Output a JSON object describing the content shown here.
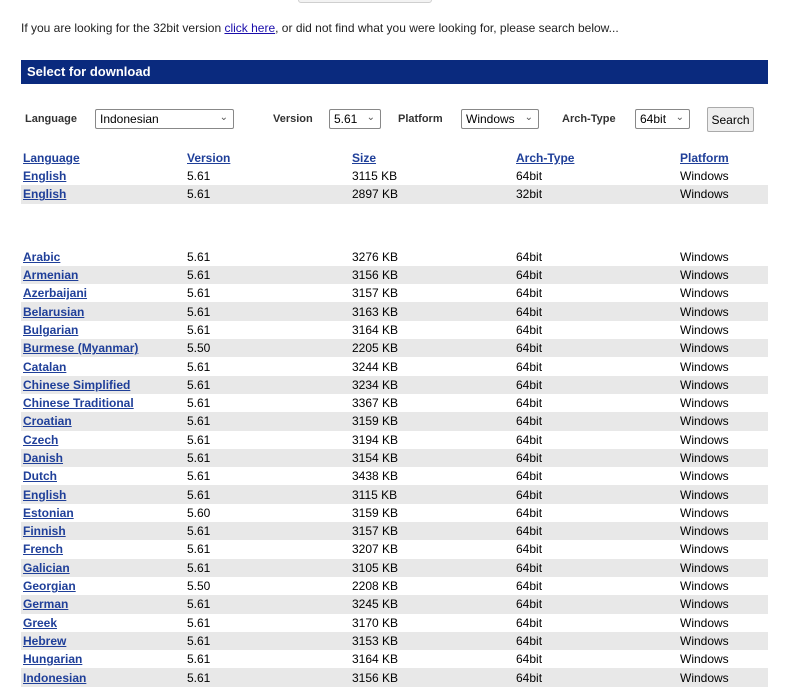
{
  "intro": {
    "before": "If you are looking for the 32bit version ",
    "link": "click here",
    "after": ", or did not find what you were looking for, please search below..."
  },
  "panel": {
    "title": "Select for download"
  },
  "filters": {
    "language_label": "Language",
    "language_value": "Indonesian",
    "version_label": "Version",
    "version_value": "5.61",
    "platform_label": "Platform",
    "platform_value": "Windows",
    "arch_label": "Arch-Type",
    "arch_value": "64bit",
    "search_label": "Search"
  },
  "table": {
    "headers": [
      "Language",
      "Version",
      "Size",
      "Arch-Type",
      "Platform"
    ],
    "top_rows": [
      [
        "English",
        "5.61",
        "3115 KB",
        "64bit",
        "Windows"
      ],
      [
        "English",
        "5.61",
        "2897 KB",
        "32bit",
        "Windows"
      ]
    ],
    "rows": [
      [
        "Arabic",
        "5.61",
        "3276 KB",
        "64bit",
        "Windows"
      ],
      [
        "Armenian",
        "5.61",
        "3156 KB",
        "64bit",
        "Windows"
      ],
      [
        "Azerbaijani",
        "5.61",
        "3157 KB",
        "64bit",
        "Windows"
      ],
      [
        "Belarusian",
        "5.61",
        "3163 KB",
        "64bit",
        "Windows"
      ],
      [
        "Bulgarian",
        "5.61",
        "3164 KB",
        "64bit",
        "Windows"
      ],
      [
        "Burmese (Myanmar)",
        "5.50",
        "2205 KB",
        "64bit",
        "Windows"
      ],
      [
        "Catalan",
        "5.61",
        "3244 KB",
        "64bit",
        "Windows"
      ],
      [
        "Chinese Simplified",
        "5.61",
        "3234 KB",
        "64bit",
        "Windows"
      ],
      [
        "Chinese Traditional",
        "5.61",
        "3367 KB",
        "64bit",
        "Windows"
      ],
      [
        "Croatian",
        "5.61",
        "3159 KB",
        "64bit",
        "Windows"
      ],
      [
        "Czech",
        "5.61",
        "3194 KB",
        "64bit",
        "Windows"
      ],
      [
        "Danish",
        "5.61",
        "3154 KB",
        "64bit",
        "Windows"
      ],
      [
        "Dutch",
        "5.61",
        "3438 KB",
        "64bit",
        "Windows"
      ],
      [
        "English",
        "5.61",
        "3115 KB",
        "64bit",
        "Windows"
      ],
      [
        "Estonian",
        "5.60",
        "3159 KB",
        "64bit",
        "Windows"
      ],
      [
        "Finnish",
        "5.61",
        "3157 KB",
        "64bit",
        "Windows"
      ],
      [
        "French",
        "5.61",
        "3207 KB",
        "64bit",
        "Windows"
      ],
      [
        "Galician",
        "5.61",
        "3105 KB",
        "64bit",
        "Windows"
      ],
      [
        "Georgian",
        "5.50",
        "2208 KB",
        "64bit",
        "Windows"
      ],
      [
        "German",
        "5.61",
        "3245 KB",
        "64bit",
        "Windows"
      ],
      [
        "Greek",
        "5.61",
        "3170 KB",
        "64bit",
        "Windows"
      ],
      [
        "Hebrew",
        "5.61",
        "3153 KB",
        "64bit",
        "Windows"
      ],
      [
        "Hungarian",
        "5.61",
        "3164 KB",
        "64bit",
        "Windows"
      ],
      [
        "Indonesian",
        "5.61",
        "3156 KB",
        "64bit",
        "Windows"
      ]
    ]
  }
}
